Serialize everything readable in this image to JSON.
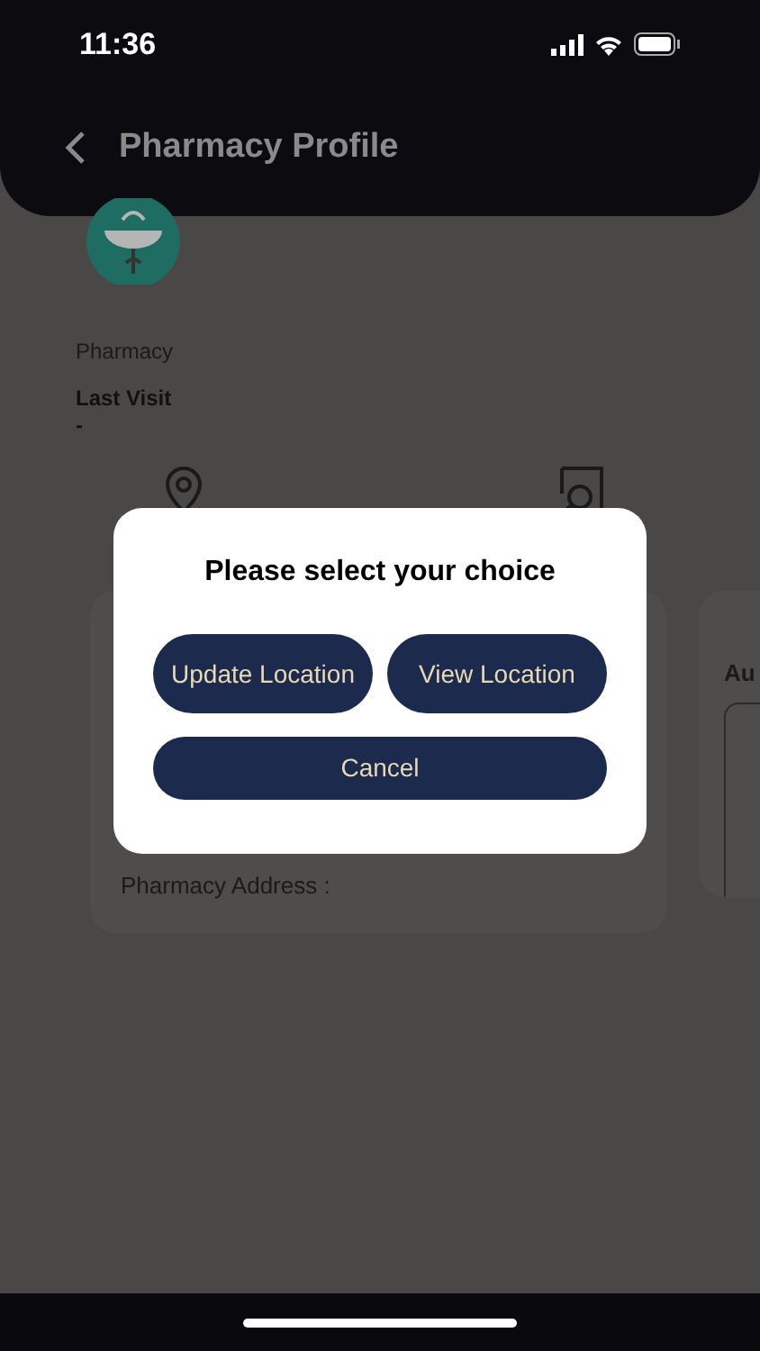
{
  "status_bar": {
    "time": "11:36"
  },
  "header": {
    "title": "Pharmacy Profile"
  },
  "profile": {
    "type_label": "Pharmacy",
    "last_visit_label": "Last Visit",
    "last_visit_value": "-"
  },
  "address_card": {
    "label": "Pharmacy Address :"
  },
  "side_card": {
    "title": "Au"
  },
  "dialog": {
    "title": "Please select your choice",
    "buttons": [
      {
        "label": "Update Location",
        "kind": "half"
      },
      {
        "label": "View Location",
        "kind": "half"
      },
      {
        "label": "Cancel",
        "kind": "full"
      }
    ]
  }
}
